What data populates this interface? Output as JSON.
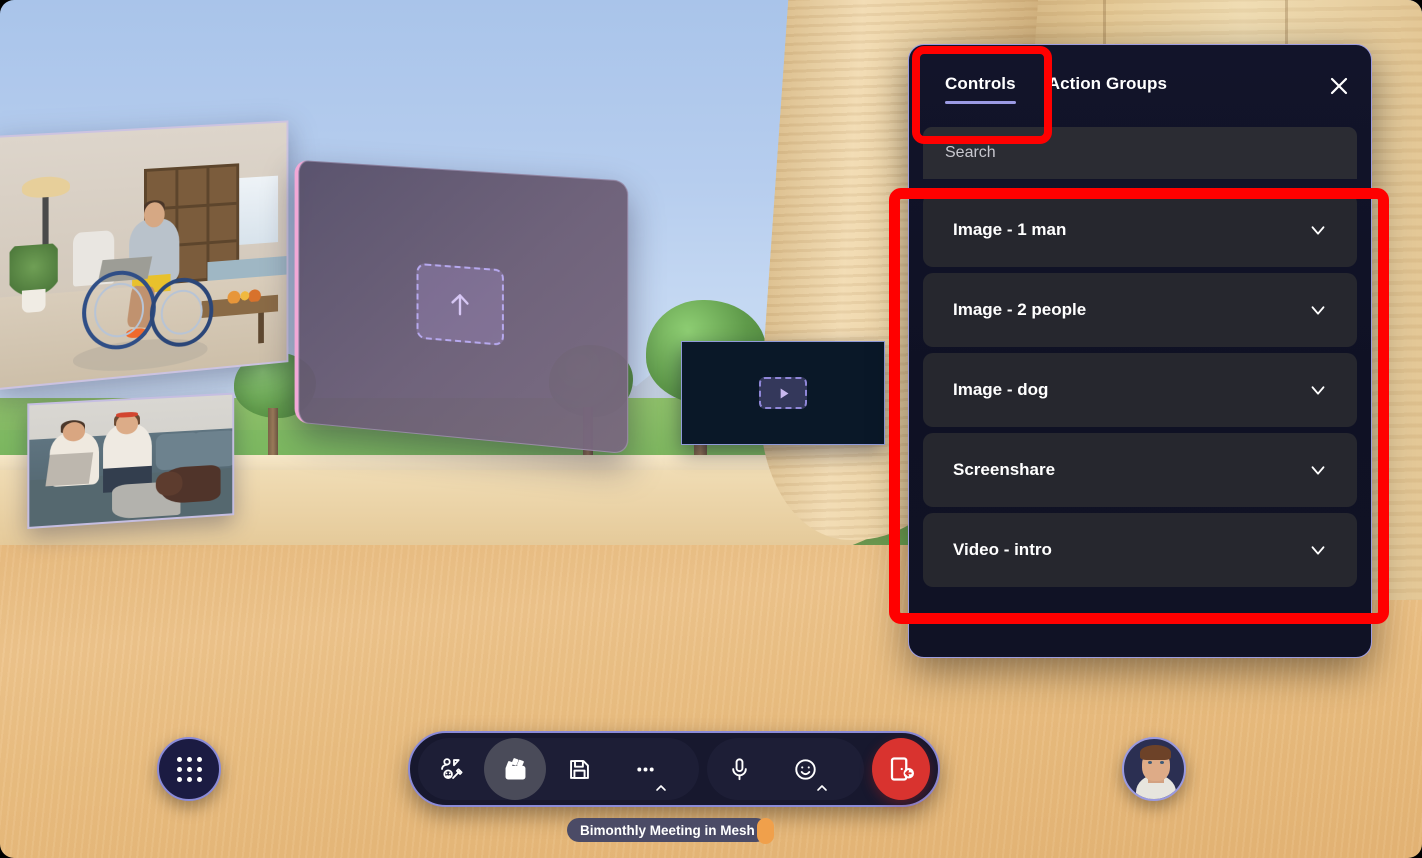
{
  "panel": {
    "tabs": [
      {
        "label": "Controls",
        "active": true
      },
      {
        "label": "Action Groups",
        "active": false
      }
    ],
    "close_label": "Close",
    "search": {
      "placeholder": "Search",
      "value": ""
    },
    "items": [
      {
        "label": "Image - 1 man"
      },
      {
        "label": "Image - 2 people"
      },
      {
        "label": "Image - dog"
      },
      {
        "label": "Screenshare"
      },
      {
        "label": "Video - intro"
      }
    ]
  },
  "toolbar": {
    "apps_label": "Apps",
    "buttons": [
      {
        "name": "avatar-customize",
        "label": "Avatar",
        "active": false
      },
      {
        "name": "media-clapperboard",
        "label": "Media",
        "active": true
      },
      {
        "name": "save",
        "label": "Save",
        "active": false
      },
      {
        "name": "more",
        "label": "More",
        "active": false
      },
      {
        "name": "microphone",
        "label": "Mic",
        "active": false
      },
      {
        "name": "reactions",
        "label": "Reactions",
        "active": false
      }
    ],
    "leave_label": "Leave"
  },
  "status": {
    "meeting_name": "Bimonthly Meeting in Mesh"
  },
  "scene": {
    "screenshare_panel": {
      "hint": "Upload"
    },
    "video_panel": {
      "hint": "Play"
    },
    "photos": [
      {
        "name": "man-in-wheelchair-with-laptop"
      },
      {
        "name": "two-people-on-couch-with-dog"
      }
    ]
  },
  "colors": {
    "accent": "#9b9ae3",
    "panel_bg": "#12142a",
    "row_bg": "#26272e",
    "highlight": "#ff0000",
    "leave": "#d9332f",
    "orange": "#f0a04b"
  }
}
